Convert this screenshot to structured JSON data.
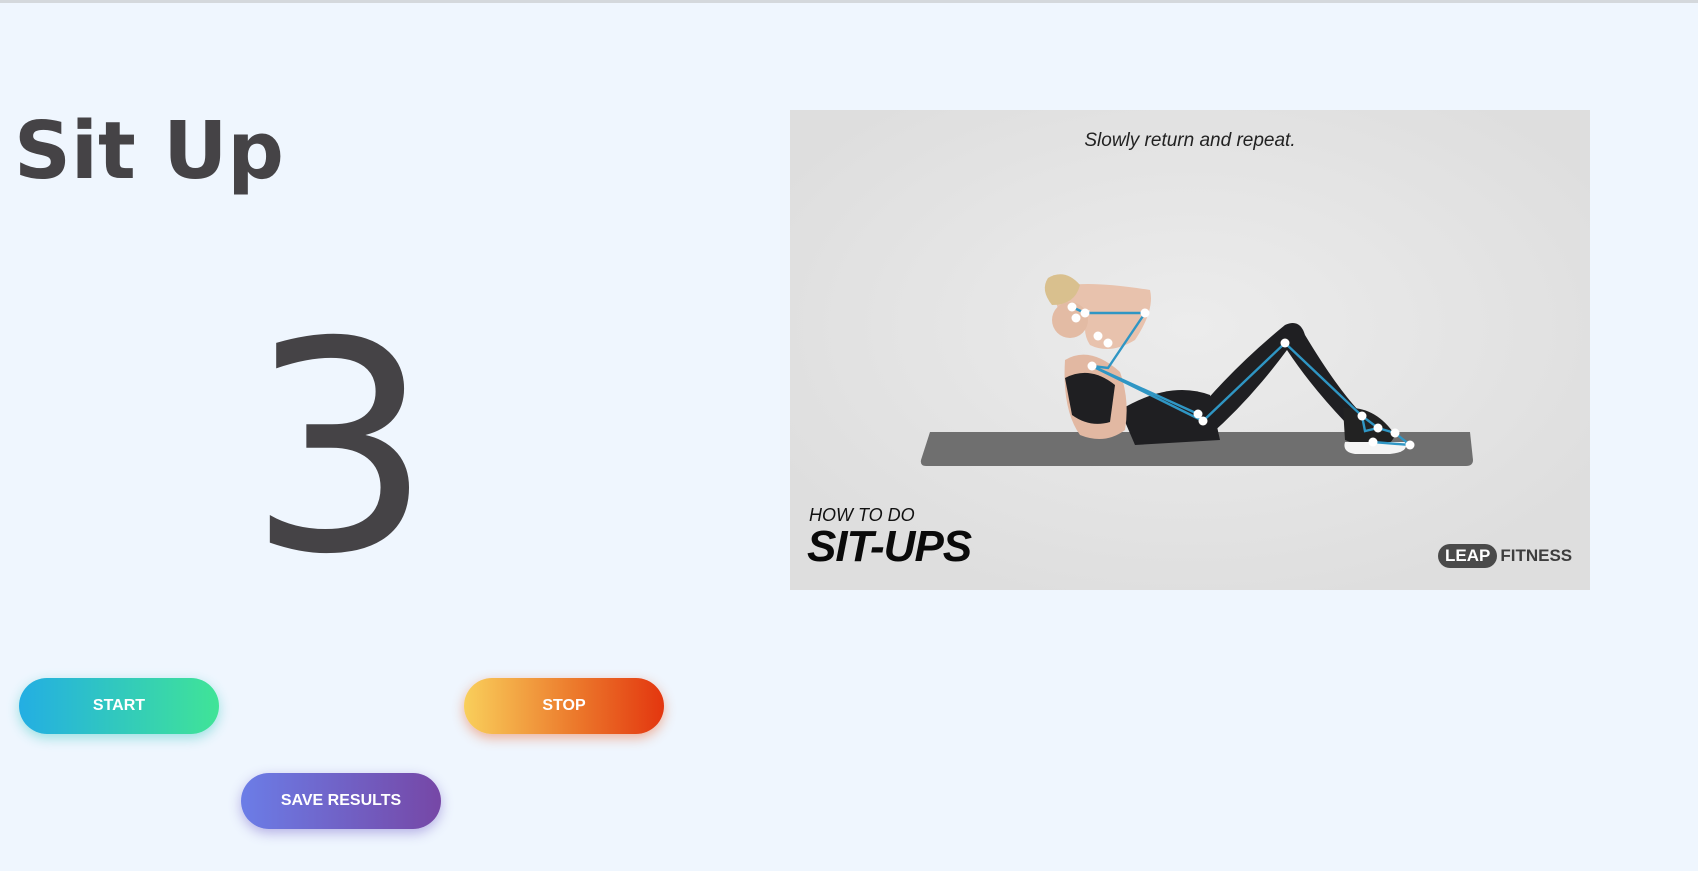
{
  "page": {
    "title": "Sit Up",
    "rep_count": "3"
  },
  "buttons": {
    "start_label": "START",
    "stop_label": "STOP",
    "save_label": "SAVE RESULTS"
  },
  "video": {
    "caption": "Slowly return and repeat.",
    "howto_small": "HOW TO DO",
    "howto_big": "SIT-UPS",
    "brand_leap": "LEAP",
    "brand_fitness": "FITNESS"
  },
  "colors": {
    "background": "#eff6fe",
    "text": "#454346",
    "start_gradient": [
      "#23aee3",
      "#40e497"
    ],
    "stop_gradient": [
      "#f9cf5b",
      "#e3360f"
    ],
    "save_gradient": [
      "#6b7de7",
      "#7647a6"
    ],
    "pose_skeleton": "#2f96c4"
  }
}
